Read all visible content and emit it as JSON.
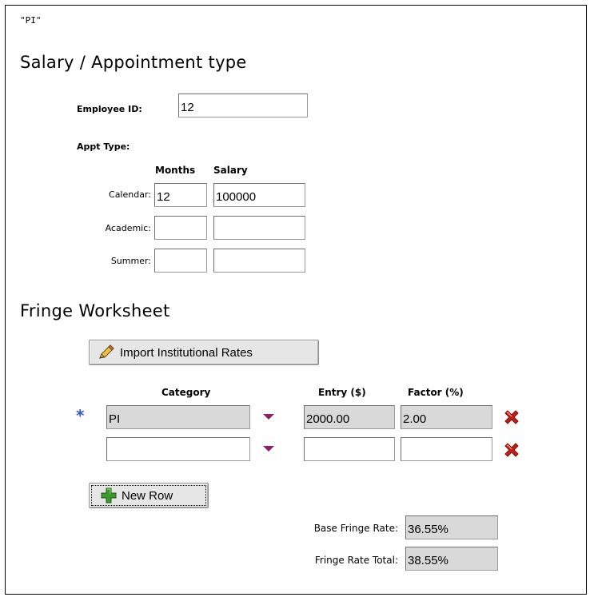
{
  "top_code": "\"PI\"",
  "salary_section": {
    "heading": "Salary / Appointment type",
    "employee_id_label": "Employee ID:",
    "employee_id_value": "12",
    "appt_type_label": "Appt Type:",
    "col_months": "Months",
    "col_salary": "Salary",
    "rows": [
      {
        "label": "Calendar:",
        "months": "12",
        "salary": "100000"
      },
      {
        "label": "Academic:",
        "months": "",
        "salary": ""
      },
      {
        "label": "Summer:",
        "months": "",
        "salary": ""
      }
    ]
  },
  "fringe_section": {
    "heading": "Fringe Worksheet",
    "import_button": "Import Institutional Rates",
    "col_category": "Category",
    "col_entry": "Entry ($)",
    "col_factor": "Factor (%)",
    "required_marker": "*",
    "rows": [
      {
        "category": "PI",
        "entry": "2000.00",
        "factor": "2.00"
      },
      {
        "category": "",
        "entry": "",
        "factor": ""
      }
    ],
    "new_row_button": "New Row",
    "base_rate_label": "Base Fringe Rate:",
    "base_rate_value": "36.55%",
    "total_rate_label": "Fringe Rate Total:",
    "total_rate_value": "38.55%"
  },
  "colors": {
    "required_star": "#3355dd",
    "delete_icon": "#c0201a",
    "add_icon": "#3a9a2a",
    "dropdown_arrow": "#8a1f6a",
    "readonly_field": "#d9d9d9"
  },
  "icons": [
    "pencil-icon",
    "dropdown-arrow-icon",
    "delete-row-icon",
    "add-icon"
  ]
}
